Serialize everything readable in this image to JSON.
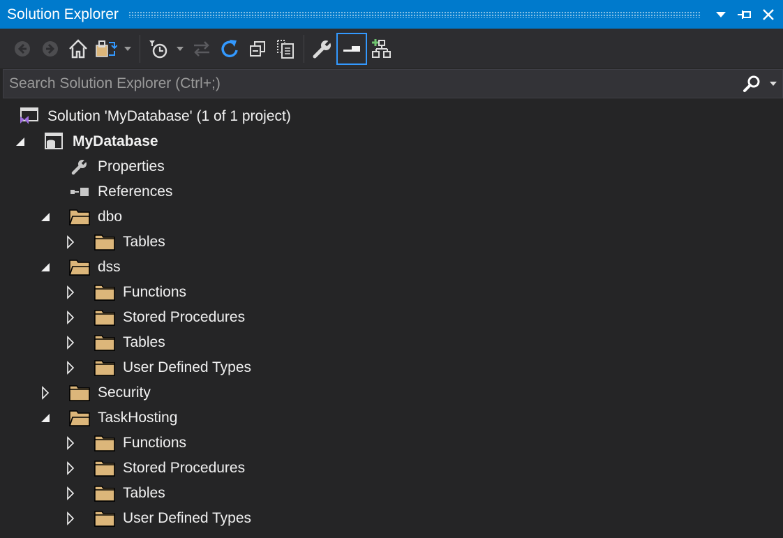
{
  "window": {
    "title": "Solution Explorer",
    "accent": "#007acc"
  },
  "toolbar": {
    "buttons": [
      {
        "name": "back",
        "icon": "arrow-left-circle-icon"
      },
      {
        "name": "forward",
        "icon": "arrow-right-circle-icon"
      },
      {
        "name": "home",
        "icon": "home-icon"
      },
      {
        "name": "switch-views",
        "icon": "switch-views-icon"
      },
      {
        "name": "pending-changes-filter",
        "icon": "clock-filter-icon"
      },
      {
        "name": "sync-with-active-document",
        "icon": "sync-arrows-icon"
      },
      {
        "name": "refresh",
        "icon": "refresh-icon"
      },
      {
        "name": "collapse-all",
        "icon": "collapse-all-icon"
      },
      {
        "name": "show-all-files",
        "icon": "show-all-files-icon"
      },
      {
        "name": "properties",
        "icon": "wrench-icon"
      },
      {
        "name": "preview-selected-items",
        "icon": "preview-icon"
      },
      {
        "name": "schema-view",
        "icon": "hierarchy-add-icon"
      }
    ]
  },
  "search": {
    "placeholder": "Search Solution Explorer (Ctrl+;)",
    "value": ""
  },
  "tree": {
    "solution": {
      "label": "Solution 'MyDatabase' (1 of 1 project)"
    },
    "project": {
      "label": "MyDatabase"
    },
    "properties": {
      "label": "Properties"
    },
    "references": {
      "label": "References"
    },
    "dbo": {
      "label": "dbo",
      "tables": "Tables"
    },
    "dss": {
      "label": "dss",
      "functions": "Functions",
      "stored_procedures": "Stored Procedures",
      "tables": "Tables",
      "user_defined_types": "User Defined Types"
    },
    "security": {
      "label": "Security"
    },
    "taskhosting": {
      "label": "TaskHosting",
      "functions": "Functions",
      "stored_procedures": "Stored Procedures",
      "tables": "Tables",
      "user_defined_types": "User Defined Types"
    }
  },
  "colors": {
    "folder": "#dcb67a",
    "background": "#252526",
    "toolbar": "#2d2d30",
    "text": "#f1f1f1",
    "active_outline": "#3399ff"
  }
}
